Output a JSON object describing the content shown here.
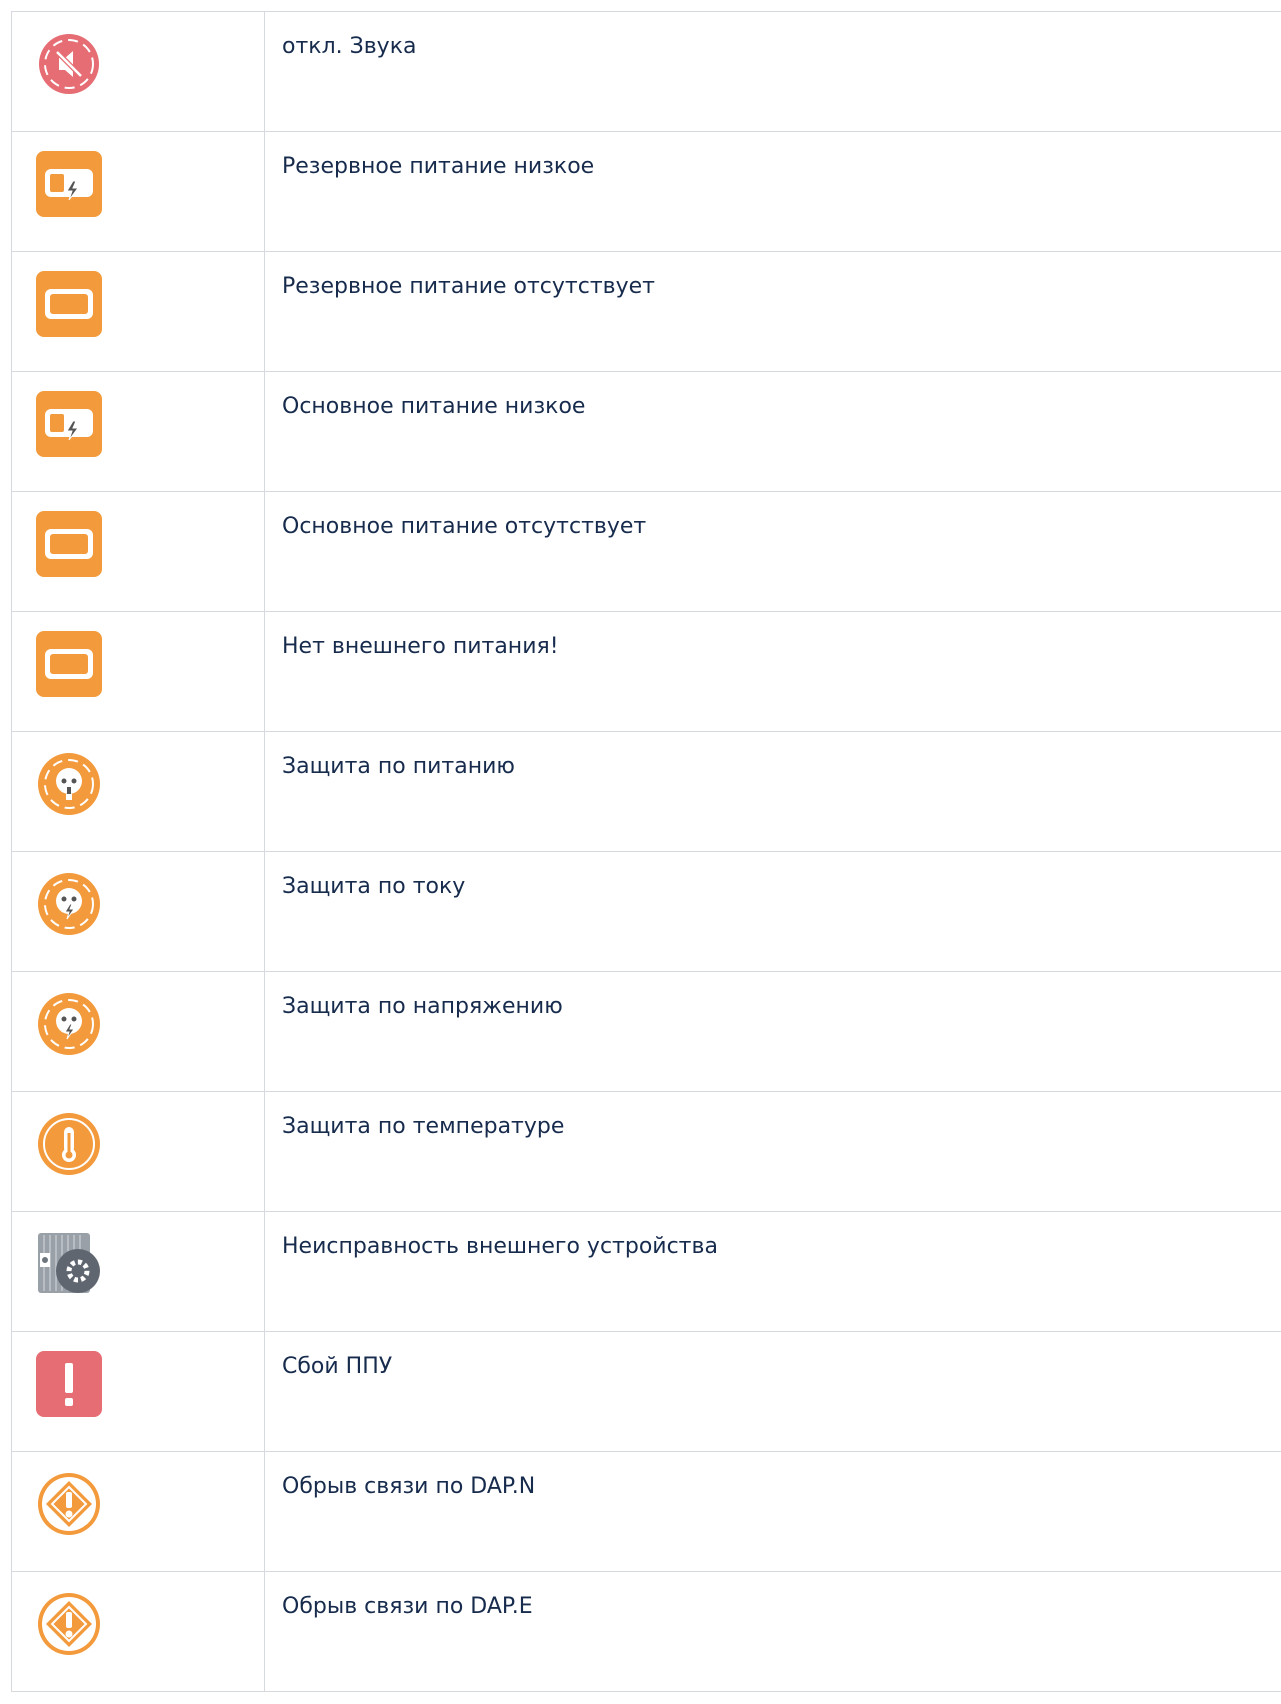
{
  "rows": [
    {
      "icon": "sound-off-icon",
      "text": "откл. Звука"
    },
    {
      "icon": "backup-power-low-icon",
      "text": "Резервное питание низкое"
    },
    {
      "icon": "battery-icon",
      "text": "Резервное питание отсутствует"
    },
    {
      "icon": "main-power-low-icon",
      "text": "Основное питание низкое"
    },
    {
      "icon": "battery-icon",
      "text": "Основное питание отсутствует"
    },
    {
      "icon": "battery-icon",
      "text": "Нет внешнего питания!"
    },
    {
      "icon": "power-protection-icon",
      "text": "Защита по питанию"
    },
    {
      "icon": "current-protection-icon",
      "text": "Защита по току"
    },
    {
      "icon": "voltage-protection-icon",
      "text": "Защита по напряжению"
    },
    {
      "icon": "temperature-protection-icon",
      "text": "Защита по температуре"
    },
    {
      "icon": "external-device-fault-icon",
      "text": "Неисправность внешнего устройства"
    },
    {
      "icon": "exclamation-icon",
      "text": "Сбой ППУ"
    },
    {
      "icon": "link-loss-icon",
      "text": "Обрыв связи по DAP.N"
    },
    {
      "icon": "link-loss-icon",
      "text": "Обрыв связи по DAP.E"
    }
  ],
  "colors": {
    "orange": "#f39a3c",
    "red": "#e56d73",
    "grid": "#d6d9de",
    "text": "#172b4d",
    "gray": "#8a9099"
  }
}
